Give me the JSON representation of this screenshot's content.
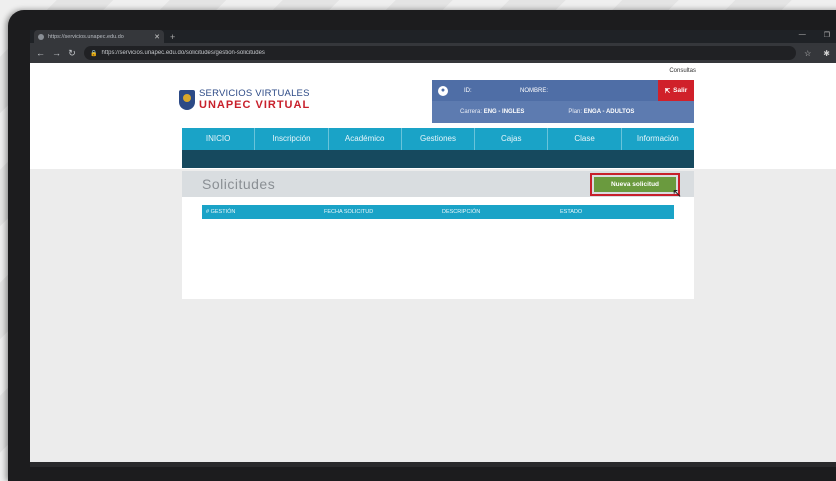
{
  "browser": {
    "tab_title": "https://servicios.unapec.edu.do",
    "url": "https://servicios.unapec.edu.do/solicitudes/gestion-solicitudes"
  },
  "header": {
    "consultas": "Consultas",
    "logo_line1": "SERVICIOS VIRTUALES",
    "logo_line2": "UNAPEC VIRTUAL",
    "id_label": "ID:",
    "name_label": "NOMBRE:",
    "salir_label": "Salir",
    "carrera_label": "Carrera:",
    "carrera_value": "ENG - INGLES",
    "plan_label": "Plan:",
    "plan_value": "ENGA - ADULTOS"
  },
  "menu": {
    "items": [
      {
        "label": "INICIO"
      },
      {
        "label": "Inscripción"
      },
      {
        "label": "Académico"
      },
      {
        "label": "Gestiones"
      },
      {
        "label": "Cajas"
      },
      {
        "label": "Clase"
      },
      {
        "label": "Información"
      }
    ]
  },
  "card": {
    "title": "Solicitudes",
    "new_button": "Nueva solicitud",
    "columns": [
      "# GESTIÓN",
      "FECHA SOLICITUD",
      "DESCRIPCIÓN",
      "ESTADO"
    ]
  },
  "colors": {
    "brand_blue": "#2c4a86",
    "brand_red": "#c8202b",
    "menu_cyan": "#1aa3c7",
    "button_green": "#6a9a3e"
  }
}
